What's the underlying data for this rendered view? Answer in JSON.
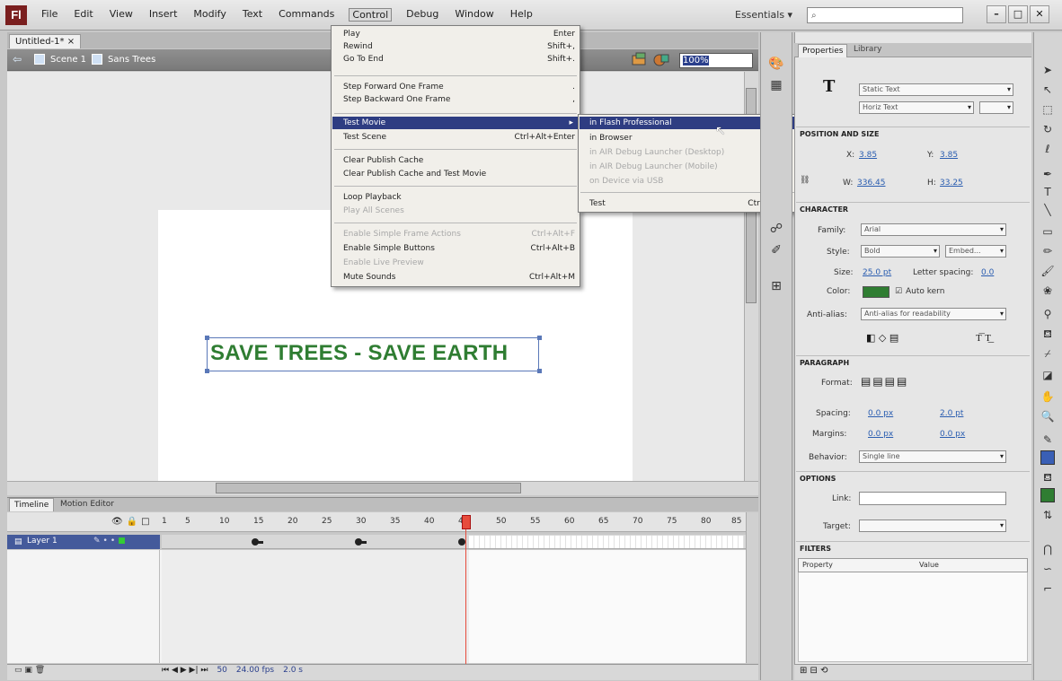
{
  "app": {
    "logo_text": "Fl",
    "workspace": "Essentials ▾",
    "search_value": "",
    "menus": [
      "File",
      "Edit",
      "View",
      "Insert",
      "Modify",
      "Text",
      "Commands",
      "Control",
      "Debug",
      "Window",
      "Help"
    ],
    "active_menu": "Control",
    "window_buttons": [
      "–",
      "□",
      "✕"
    ]
  },
  "document": {
    "tab_label": "Untitled-1* ×",
    "scene_label": "Scene 1",
    "edit_label": "Sans Trees",
    "zoom": "100%",
    "stage_text": "SAVE TREES - SAVE EARTH"
  },
  "control_menu": {
    "items": [
      {
        "label": "Play",
        "shortcut": "Enter",
        "enabled": true
      },
      {
        "label": "Rewind",
        "shortcut": "Shift+,",
        "enabled": true
      },
      {
        "label": "Go To End",
        "shortcut": "Shift+.",
        "enabled": true
      },
      {
        "label": "Step Forward One Frame",
        "shortcut": ".",
        "enabled": true
      },
      {
        "label": "Step Backward One Frame",
        "shortcut": ",",
        "enabled": true
      },
      {
        "label": "Test Movie",
        "shortcut": "▸",
        "enabled": true,
        "highlighted": true
      },
      {
        "label": "Test Scene",
        "shortcut": "Ctrl+Alt+Enter",
        "enabled": true
      },
      {
        "label": "Clear Publish Cache",
        "shortcut": "",
        "enabled": true
      },
      {
        "label": "Clear Publish Cache and Test Movie",
        "shortcut": "",
        "enabled": true
      },
      {
        "label": "Loop Playback",
        "shortcut": "",
        "enabled": true
      },
      {
        "label": "Play All Scenes",
        "shortcut": "",
        "enabled": false
      },
      {
        "label": "Enable Simple Frame Actions",
        "shortcut": "Ctrl+Alt+F",
        "enabled": false
      },
      {
        "label": "Enable Simple Buttons",
        "shortcut": "Ctrl+Alt+B",
        "enabled": true
      },
      {
        "label": "Enable Live Preview",
        "shortcut": "",
        "enabled": false
      },
      {
        "label": "Mute Sounds",
        "shortcut": "Ctrl+Alt+M",
        "enabled": true
      }
    ]
  },
  "test_submenu": {
    "items": [
      {
        "label": "in Flash Professional",
        "shortcut": "",
        "enabled": true,
        "highlighted": true
      },
      {
        "label": "in Browser",
        "shortcut": "",
        "enabled": true
      },
      {
        "label": "in AIR Debug Launcher (Desktop)",
        "shortcut": "",
        "enabled": false
      },
      {
        "label": "in AIR Debug Launcher (Mobile)",
        "shortcut": "",
        "enabled": false
      },
      {
        "label": "on Device via USB",
        "shortcut": "",
        "enabled": false
      },
      {
        "label": "Test",
        "shortcut": "Ctrl+Enter",
        "enabled": true
      }
    ]
  },
  "timeline": {
    "tabs": [
      "Timeline",
      "Motion Editor"
    ],
    "layer_name": "Layer 1",
    "ruler_labels": [
      "1",
      "5",
      "10",
      "15",
      "20",
      "25",
      "30",
      "35",
      "40",
      "45",
      "50",
      "55",
      "60",
      "65",
      "70",
      "75",
      "80",
      "85"
    ],
    "status": [
      "50",
      "24.00 fps",
      "2.0 s"
    ]
  },
  "properties": {
    "tabs": [
      "Properties",
      "Library"
    ],
    "text_type": "Static Text",
    "text_direction": "Horiz Text",
    "sections": {
      "position": "POSITION AND SIZE",
      "character": "CHARACTER",
      "paragraph": "PARAGRAPH",
      "options": "OPTIONS",
      "filters": "FILTERS"
    },
    "x_label": "X:",
    "x_value": "3.85",
    "y_label": "Y:",
    "y_value": "3.85",
    "w_label": "W:",
    "w_value": "336.45",
    "h_label": "H:",
    "h_value": "33.25",
    "family_label": "Family:",
    "family_value": "Arial",
    "style_label": "Style:",
    "style_value": "Bold",
    "embed_label": "Embed...",
    "size_label": "Size:",
    "size_value": "25.0 pt",
    "spacing_label": "Letter spacing:",
    "spacing_value": "0.0",
    "color_label": "Color:",
    "autokern_label": "Auto kern",
    "antialias_label": "Anti-alias:",
    "antialias_value": "Anti-alias for readability",
    "format_label": "Format:",
    "spacing_para_label": "Spacing:",
    "spacing_para_value1": "0.0 px",
    "spacing_para_value2": "2.0 pt",
    "margins_label": "Margins:",
    "margins_value1": "0.0 px",
    "margins_value2": "0.0 px",
    "behavior_label": "Behavior:",
    "behavior_value": "Single line",
    "link_label": "Link:",
    "target_label": "Target:",
    "filters_cols": [
      "Property",
      "Value"
    ]
  },
  "colors": {
    "stage_text": "#2f7d32",
    "menu_highlight": "#2e3d82",
    "playhead": "#e74c3c"
  }
}
